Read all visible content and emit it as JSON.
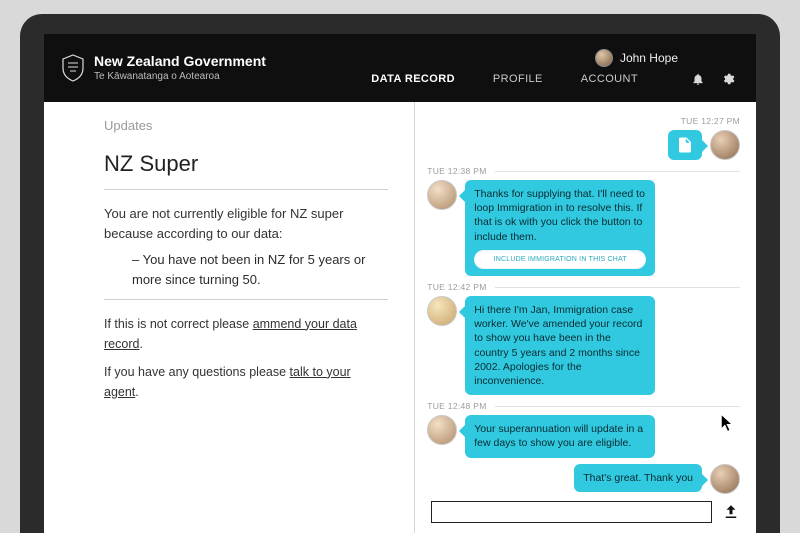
{
  "brand": {
    "main": "New Zealand Government",
    "sub": "Te Kāwanatanga o Aotearoa"
  },
  "user": {
    "name": "John Hope"
  },
  "nav": {
    "items": [
      {
        "label": "DATA RECORD",
        "active": true
      },
      {
        "label": "PROFILE",
        "active": false
      },
      {
        "label": "ACCOUNT",
        "active": false
      }
    ]
  },
  "document": {
    "section_label": "Updates",
    "title": "NZ Super",
    "intro": "You are not currently eligible for NZ super because according to our data:",
    "reason": "– You have not been in NZ for 5 years or more since turning 50.",
    "footer_prefix1": "If this is not correct please ",
    "footer_link1": "ammend your data record",
    "footer_suffix1": ".",
    "footer_prefix2": "If you have any questions please ",
    "footer_link2": "talk to your agent",
    "footer_suffix2": "."
  },
  "chat": {
    "ts0": "TUE 12:27 PM",
    "ts1": "TUE 12:38 PM",
    "ts2": "TUE 12:42 PM",
    "ts3": "TUE 12:48 PM",
    "msg1": "Thanks for supplying that.  I'll need to loop Immigration in to resolve this. If that is ok with you click the button to include them.",
    "action1": "INCLUDE IMMIGRATION IN THIS CHAT",
    "msg2": "Hi there I'm Jan, Immigration case worker. We've amended your record to show you have been in the country 5 years and 2 months since 2002. Apologies for the inconvenience.",
    "msg3": "Your superannuation will update in a few days to show you are eligible.",
    "msg4": "That's great. Thank you",
    "compose_placeholder": ""
  }
}
